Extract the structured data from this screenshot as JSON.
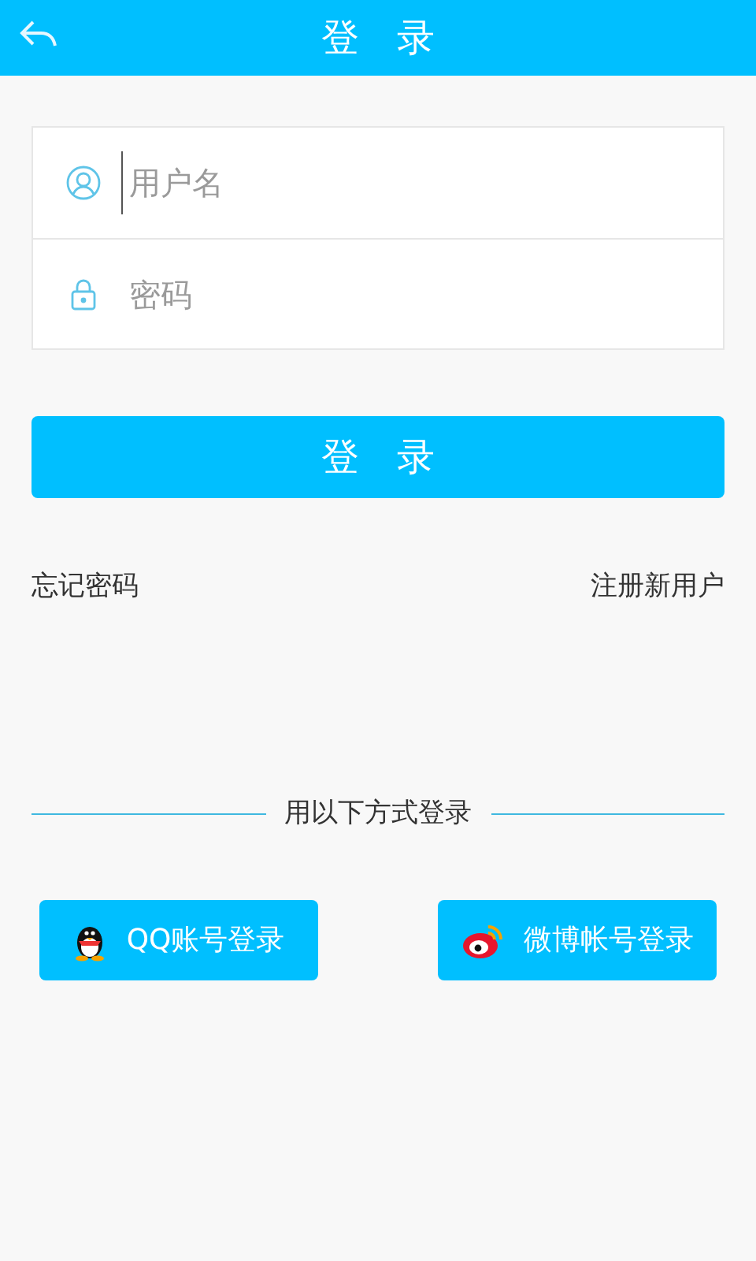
{
  "header": {
    "title": "登　录"
  },
  "fields": [
    {
      "kind": "user",
      "placeholder": "用户名",
      "focused": true
    },
    {
      "kind": "password",
      "placeholder": "密码",
      "focused": false
    }
  ],
  "login_button": "登　录",
  "links": [
    "忘记密码",
    "注册新用户"
  ],
  "divider_text": "用以下方式登录",
  "social_buttons": [
    {
      "kind": "qq",
      "label": "QQ账号登录"
    },
    {
      "kind": "weibo",
      "label": "微博帐号登录"
    }
  ]
}
